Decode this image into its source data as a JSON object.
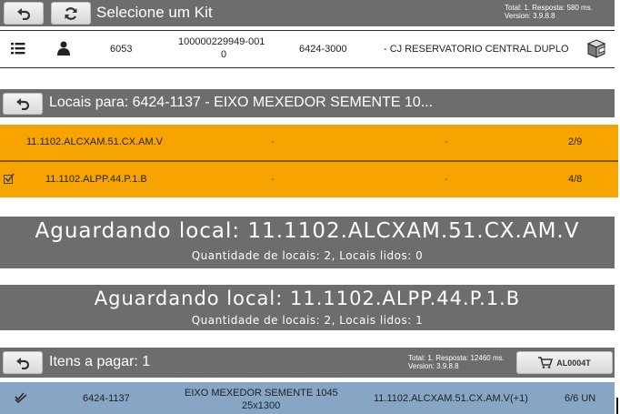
{
  "kit_header": {
    "title": "Selecione um Kit",
    "status_line1": "Total: 1. Resposta: 580 ms.",
    "status_line2": "Version: 3.9.8.8"
  },
  "kit_row": {
    "number": "6053",
    "code_line1": "100000229949-001",
    "code_line2": "0",
    "part": "6424-3000",
    "description": "- CJ RESERVATORIO CENTRAL DUPLO"
  },
  "locais_header": {
    "title": "Locais para: 6424-1137 - EIXO MEXEDOR SEMENTE 10..."
  },
  "locais": [
    {
      "location": "11.1102.ALCXAM.51.CX.AM.V",
      "col2": "-",
      "col3": "-",
      "count": "2/9",
      "checked": false
    },
    {
      "location": "11.1102.ALPP.44.P.1.B",
      "col2": "-",
      "col3": "-",
      "count": "4/8",
      "checked": true
    }
  ],
  "banner1": {
    "title": "Aguardando local: 11.1102.ALCXAM.51.CX.AM.V",
    "subtitle": "Quantidade de locais: 2, Locais lidos: 0"
  },
  "banner2": {
    "title": "Aguardando local: 11.1102.ALPP.44.P.1.B",
    "subtitle": "Quantidade de locais: 2, Locais lidos: 1"
  },
  "itens_header": {
    "title": "Itens a pagar: 1",
    "status_line1": "Total: 1. Resposta: 12460 ms.",
    "status_line2": "Version: 3.9.8.8",
    "cart_label": "AL0004T"
  },
  "item_row": {
    "part": "6424-1137",
    "desc_line1": "EIXO MEXEDOR SEMENTE 1045",
    "desc_line2": "25x1300",
    "location": "11.1102.ALCXAM.51.CX.AM.V(+1)",
    "qty": "6/6 UN"
  },
  "colors": {
    "bar_gray": "#6d6d6d",
    "row_orange": "#f8a400",
    "row_blue": "#87a5c5"
  }
}
